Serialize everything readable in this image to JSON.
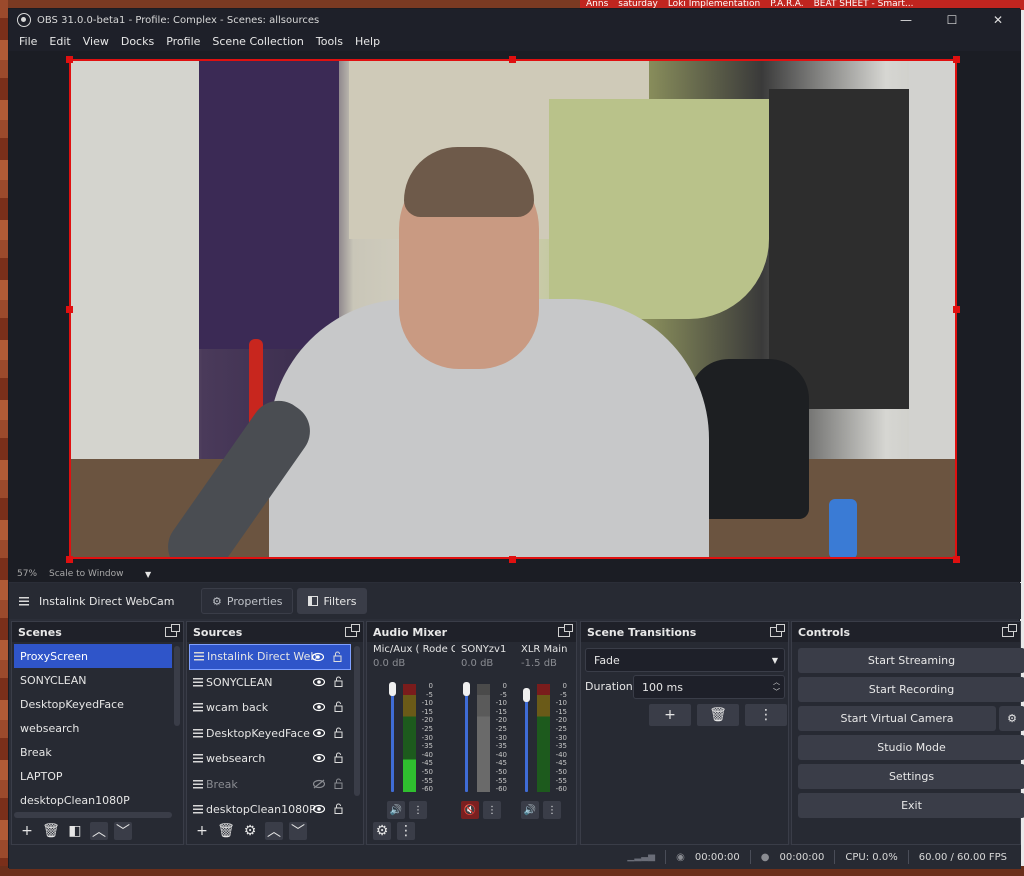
{
  "browser_tabs": [
    "Anns",
    "saturday",
    "Loki Implementation",
    "P.A.R.A.",
    "BEAT SHEET - Smart..."
  ],
  "window": {
    "title": "OBS 31.0.0-beta1 - Profile: Complex - Scenes: allsources",
    "min_glyph": "—",
    "max_glyph": "☐",
    "close_glyph": "✕"
  },
  "menu": [
    "File",
    "Edit",
    "View",
    "Docks",
    "Profile",
    "Scene Collection",
    "Tools",
    "Help"
  ],
  "preview": {
    "zoom": "57%",
    "scale_mode": "Scale to Window"
  },
  "source_toolbar": {
    "source_name": "Instalink Direct WebCam",
    "properties_label": "Properties",
    "filters_label": "Filters"
  },
  "scenes": {
    "title": "Scenes",
    "items": [
      "ProxyScreen",
      "SONYCLEAN",
      "DesktopKeyedFace",
      "websearch",
      "Break",
      "LAPTOP",
      "desktopClean1080P"
    ],
    "selected_index": 0
  },
  "sources": {
    "title": "Sources",
    "items": [
      {
        "name": "Instalink Direct Web",
        "visible": true
      },
      {
        "name": "SONYCLEAN",
        "visible": true
      },
      {
        "name": "wcam back",
        "visible": true
      },
      {
        "name": "DesktopKeyedFace",
        "visible": true
      },
      {
        "name": "websearch",
        "visible": true
      },
      {
        "name": "Break",
        "visible": false
      },
      {
        "name": "desktopClean1080P",
        "visible": true
      }
    ],
    "selected_index": 0
  },
  "audio_mixer": {
    "title": "Audio Mixer",
    "meter_labels": [
      "0",
      "-5",
      "-10",
      "-15",
      "-20",
      "-25",
      "-30",
      "-35",
      "-40",
      "-45",
      "-50",
      "-55",
      "-60"
    ],
    "channels": [
      {
        "name": "Mic/Aux ( Rode C",
        "db": "0.0 dB",
        "muted": false
      },
      {
        "name": "SONYzv1",
        "db": "0.0 dB",
        "muted": true
      },
      {
        "name": "XLR Main",
        "db": "-1.5 dB",
        "muted": false
      }
    ]
  },
  "scene_transitions": {
    "title": "Scene Transitions",
    "transition": "Fade",
    "duration_label": "Duration",
    "duration_value": "100 ms"
  },
  "controls": {
    "title": "Controls",
    "buttons": [
      "Start Streaming",
      "Start Recording",
      "Start Virtual Camera",
      "Studio Mode",
      "Settings",
      "Exit"
    ]
  },
  "status": {
    "stream_time": "00:00:00",
    "record_time": "00:00:00",
    "cpu": "CPU: 0.0%",
    "fps": "60.00 / 60.00 FPS"
  },
  "colors": {
    "accent": "#2f55c9",
    "selection_red": "#e01010",
    "mute_red": "#c0392b",
    "panel_bg": "#272a33"
  }
}
